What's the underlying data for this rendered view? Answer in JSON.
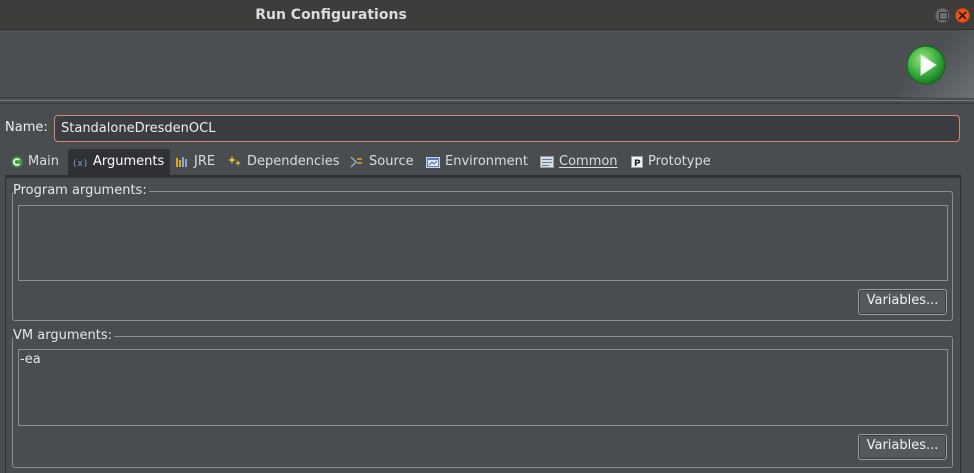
{
  "window": {
    "title": "Run Configurations"
  },
  "name_row": {
    "label": "Name:",
    "value": "StandaloneDresdenOCL"
  },
  "tabs": [
    {
      "label": "Main",
      "icon": "main-c-icon",
      "active": false
    },
    {
      "label": "Arguments",
      "icon": "arguments-icon",
      "active": true
    },
    {
      "label": "JRE",
      "icon": "jre-icon",
      "active": false
    },
    {
      "label": "Dependencies",
      "icon": "dependencies-icon",
      "active": false
    },
    {
      "label": "Source",
      "icon": "source-icon",
      "active": false
    },
    {
      "label": "Environment",
      "icon": "environment-icon",
      "active": false
    },
    {
      "label": "Common",
      "icon": "common-icon",
      "active": false
    },
    {
      "label": "Prototype",
      "icon": "prototype-icon",
      "active": false
    }
  ],
  "program_args": {
    "label": "Program arguments:",
    "value": "",
    "variables_button": "Variables..."
  },
  "vm_args": {
    "label": "VM arguments:",
    "value": "-ea",
    "variables_button": "Variables..."
  },
  "colors": {
    "background": "#4a4d50",
    "titlebar": "#3d3d3b",
    "close_button": "#e9541f",
    "run_icon": "#3cb043",
    "name_border": "#d98574"
  }
}
